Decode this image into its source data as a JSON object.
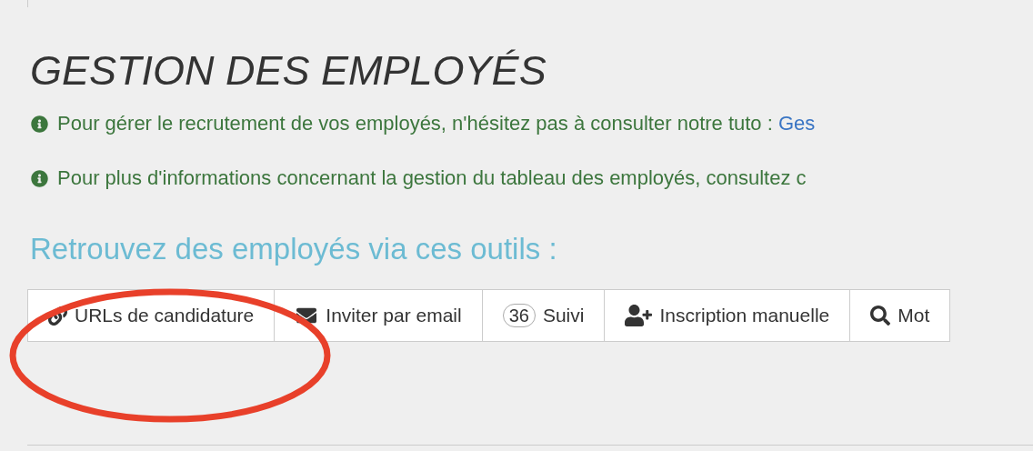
{
  "title": "GESTION DES EMPLOYÉS",
  "notices": [
    {
      "text": "Pour gérer le recrutement de vos employés, n'hésitez pas à consulter notre tuto : ",
      "link": "Ges"
    },
    {
      "text": "Pour plus d'informations concernant la gestion du tableau des employés, consultez c"
    }
  ],
  "tools_heading": "Retrouvez des employés via ces outils :",
  "tools": [
    {
      "kind": "link",
      "label": "URLs de candidature"
    },
    {
      "kind": "email",
      "label": "Inviter par email"
    },
    {
      "kind": "counter",
      "count": "36",
      "label": "Suivi"
    },
    {
      "kind": "add-user",
      "label": "Inscription manuelle"
    },
    {
      "kind": "search",
      "label": "Mot"
    }
  ]
}
